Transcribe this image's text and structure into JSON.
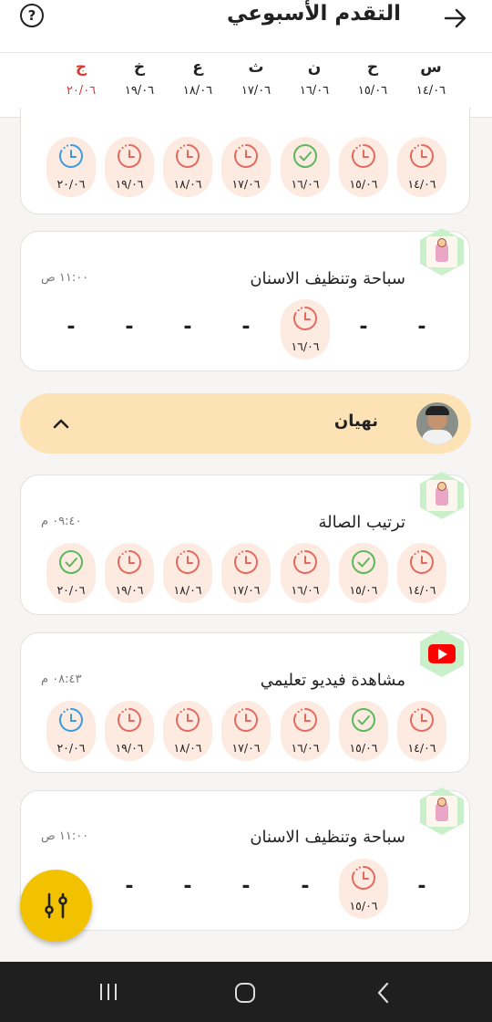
{
  "header": {
    "title": "التقدم الأسبوعي",
    "help_icon": "?"
  },
  "days": [
    {
      "letter": "س",
      "date": "١٤/٠٦",
      "today": false
    },
    {
      "letter": "ح",
      "date": "١٥/٠٦",
      "today": false
    },
    {
      "letter": "ن",
      "date": "١٦/٠٦",
      "today": false
    },
    {
      "letter": "ث",
      "date": "١٧/٠٦",
      "today": false
    },
    {
      "letter": "ع",
      "date": "١٨/٠٦",
      "today": false
    },
    {
      "letter": "خ",
      "date": "١٩/٠٦",
      "today": false
    },
    {
      "letter": "ج",
      "date": "٢٠/٠٦",
      "today": true
    }
  ],
  "cards": [
    {
      "name": "",
      "time": "",
      "thumb": "none",
      "days": [
        "clock",
        "clock",
        "check",
        "clock",
        "clock",
        "clock",
        "clock-blue"
      ]
    },
    {
      "name": "سباحة وتنظيف الاسنان",
      "time": "١١:٠٠ ص",
      "thumb": "kid",
      "days": [
        "dash",
        "dash",
        "clock",
        "dash",
        "dash",
        "dash",
        "dash"
      ]
    },
    {
      "name": "ترتيب الصالة",
      "time": "٠٩:٤٠ م",
      "thumb": "kid",
      "days": [
        "clock",
        "check",
        "clock",
        "clock",
        "clock",
        "clock",
        "check"
      ]
    },
    {
      "name": "مشاهدة فيديو تعليمي",
      "time": "٠٨:٤٣ م",
      "thumb": "youtube",
      "days": [
        "clock",
        "check",
        "clock",
        "clock",
        "clock",
        "clock",
        "clock-blue"
      ]
    },
    {
      "name": "سباحة وتنظيف الاسنان",
      "time": "١١:٠٠ ص",
      "thumb": "kid",
      "days": [
        "dash",
        "clock",
        "dash",
        "dash",
        "dash",
        "dash",
        "dash"
      ]
    }
  ],
  "user": {
    "name": "نهيان"
  },
  "colors": {
    "accent": "#f2c200",
    "today": "#d8392f",
    "clock": "#e46a5e",
    "check": "#5cb85c",
    "blue": "#3c9be0"
  },
  "icons": {
    "fab": "sliders-icon",
    "back": "arrow-right-icon"
  }
}
